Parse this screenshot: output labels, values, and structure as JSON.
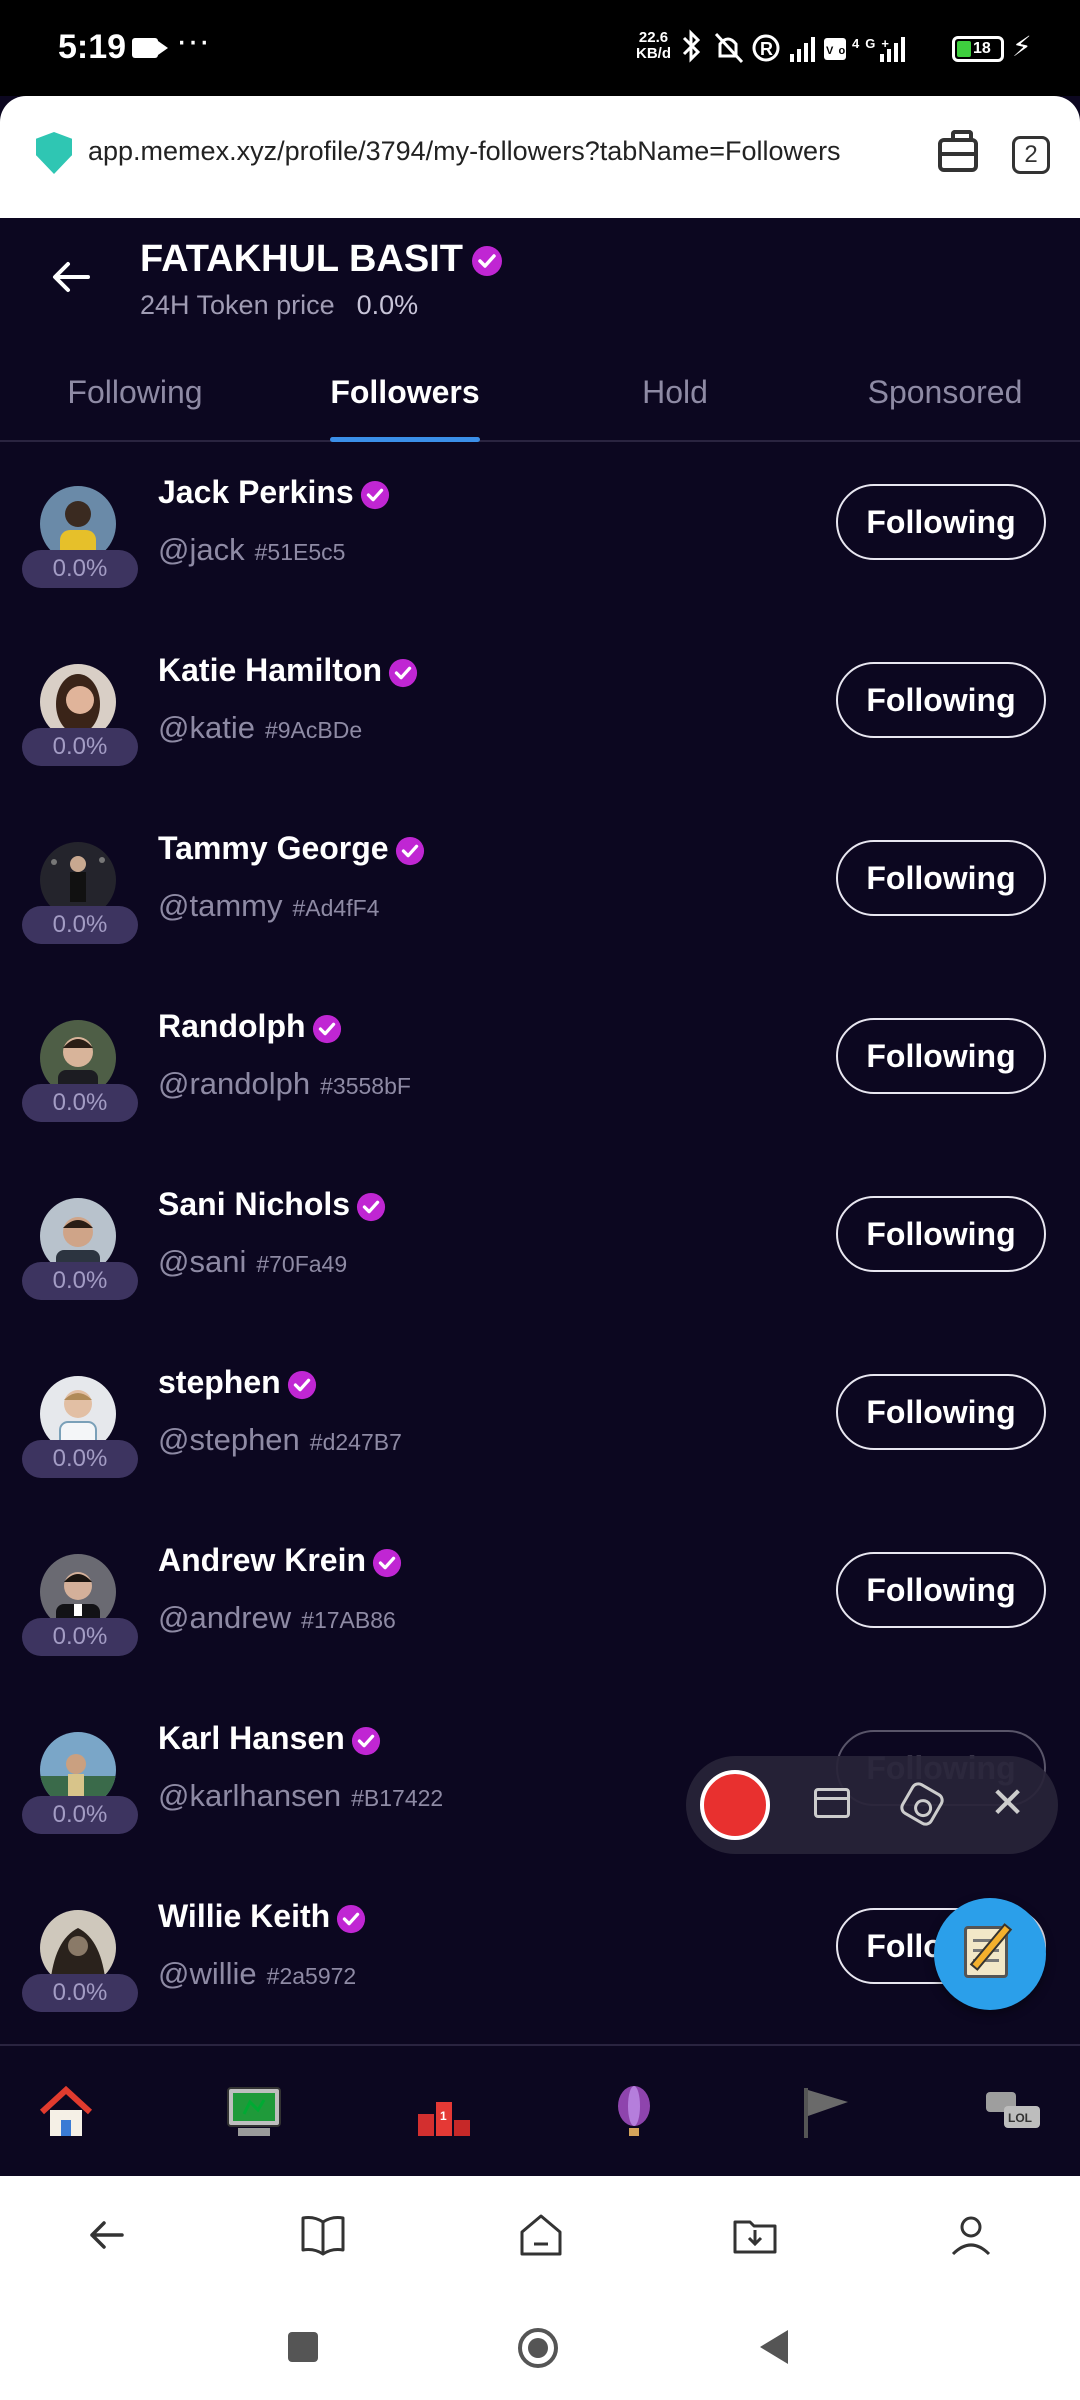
{
  "status_bar": {
    "time": "5:19",
    "network_speed_value": "22.6",
    "network_speed_unit": "KB/d",
    "battery": "18",
    "dots": "···",
    "icons": [
      "bluetooth-icon",
      "mute-icon",
      "r-icon",
      "signal-icon",
      "volte-icon",
      "4g-signal-icon"
    ]
  },
  "browser": {
    "url": "app.memex.xyz/profile/3794/my-followers?tabName=Followers",
    "tab_count": "2"
  },
  "header": {
    "name": "FATAKHUL BASIT",
    "token_label": "24H Token price",
    "token_change": "0.0%"
  },
  "tabs": [
    {
      "label": "Following"
    },
    {
      "label": "Followers"
    },
    {
      "label": "Hold"
    },
    {
      "label": "Sponsored"
    }
  ],
  "active_tab": "Followers",
  "followers": [
    {
      "name": "Jack Perkins",
      "handle": "@jack",
      "hash": "#51E5c5",
      "change": "0.0%",
      "button": "Following",
      "avatar_color": "#4a6a8a"
    },
    {
      "name": "Katie Hamilton",
      "handle": "@katie",
      "hash": "#9AcBDe",
      "change": "0.0%",
      "button": "Following",
      "avatar_color": "#b08a78"
    },
    {
      "name": "Tammy George",
      "handle": "@tammy",
      "hash": "#Ad4fF4",
      "change": "0.0%",
      "button": "Following",
      "avatar_color": "#2c2c34"
    },
    {
      "name": "Randolph",
      "handle": "@randolph",
      "hash": "#3558bF",
      "change": "0.0%",
      "button": "Following",
      "avatar_color": "#3f5040"
    },
    {
      "name": "Sani Nichols",
      "handle": "@sani",
      "hash": "#70Fa49",
      "change": "0.0%",
      "button": "Following",
      "avatar_color": "#8a95a5"
    },
    {
      "name": "stephen",
      "handle": "@stephen",
      "hash": "#d247B7",
      "change": "0.0%",
      "button": "Following",
      "avatar_color": "#c9ccd4"
    },
    {
      "name": "Andrew Krein",
      "handle": "@andrew",
      "hash": "#17AB86",
      "change": "0.0%",
      "button": "Following",
      "avatar_color": "#5a5a62"
    },
    {
      "name": "Karl Hansen",
      "handle": "@karlhansen",
      "hash": "#B17422",
      "change": "0.0%",
      "button": "Following",
      "avatar_color": "#5a7a9a"
    },
    {
      "name": "Willie Keith",
      "handle": "@willie",
      "hash": "#2a5972",
      "change": "0.0%",
      "button": "Following",
      "avatar_color": "#4a4038"
    }
  ],
  "bottom_nav": [
    {
      "icon": "home-icon"
    },
    {
      "icon": "computer-icon"
    },
    {
      "icon": "leaderboard-icon"
    },
    {
      "icon": "balloon-icon"
    },
    {
      "icon": "flag-icon"
    },
    {
      "icon": "chat-lol-icon"
    }
  ],
  "browser_nav": [
    {
      "icon": "back-icon"
    },
    {
      "icon": "book-icon"
    },
    {
      "icon": "home-outline-icon"
    },
    {
      "icon": "download-folder-icon"
    },
    {
      "icon": "profile-icon"
    }
  ],
  "recorder": {
    "icons": [
      "record-icon",
      "folder-icon",
      "settings-icon",
      "close-icon"
    ]
  }
}
